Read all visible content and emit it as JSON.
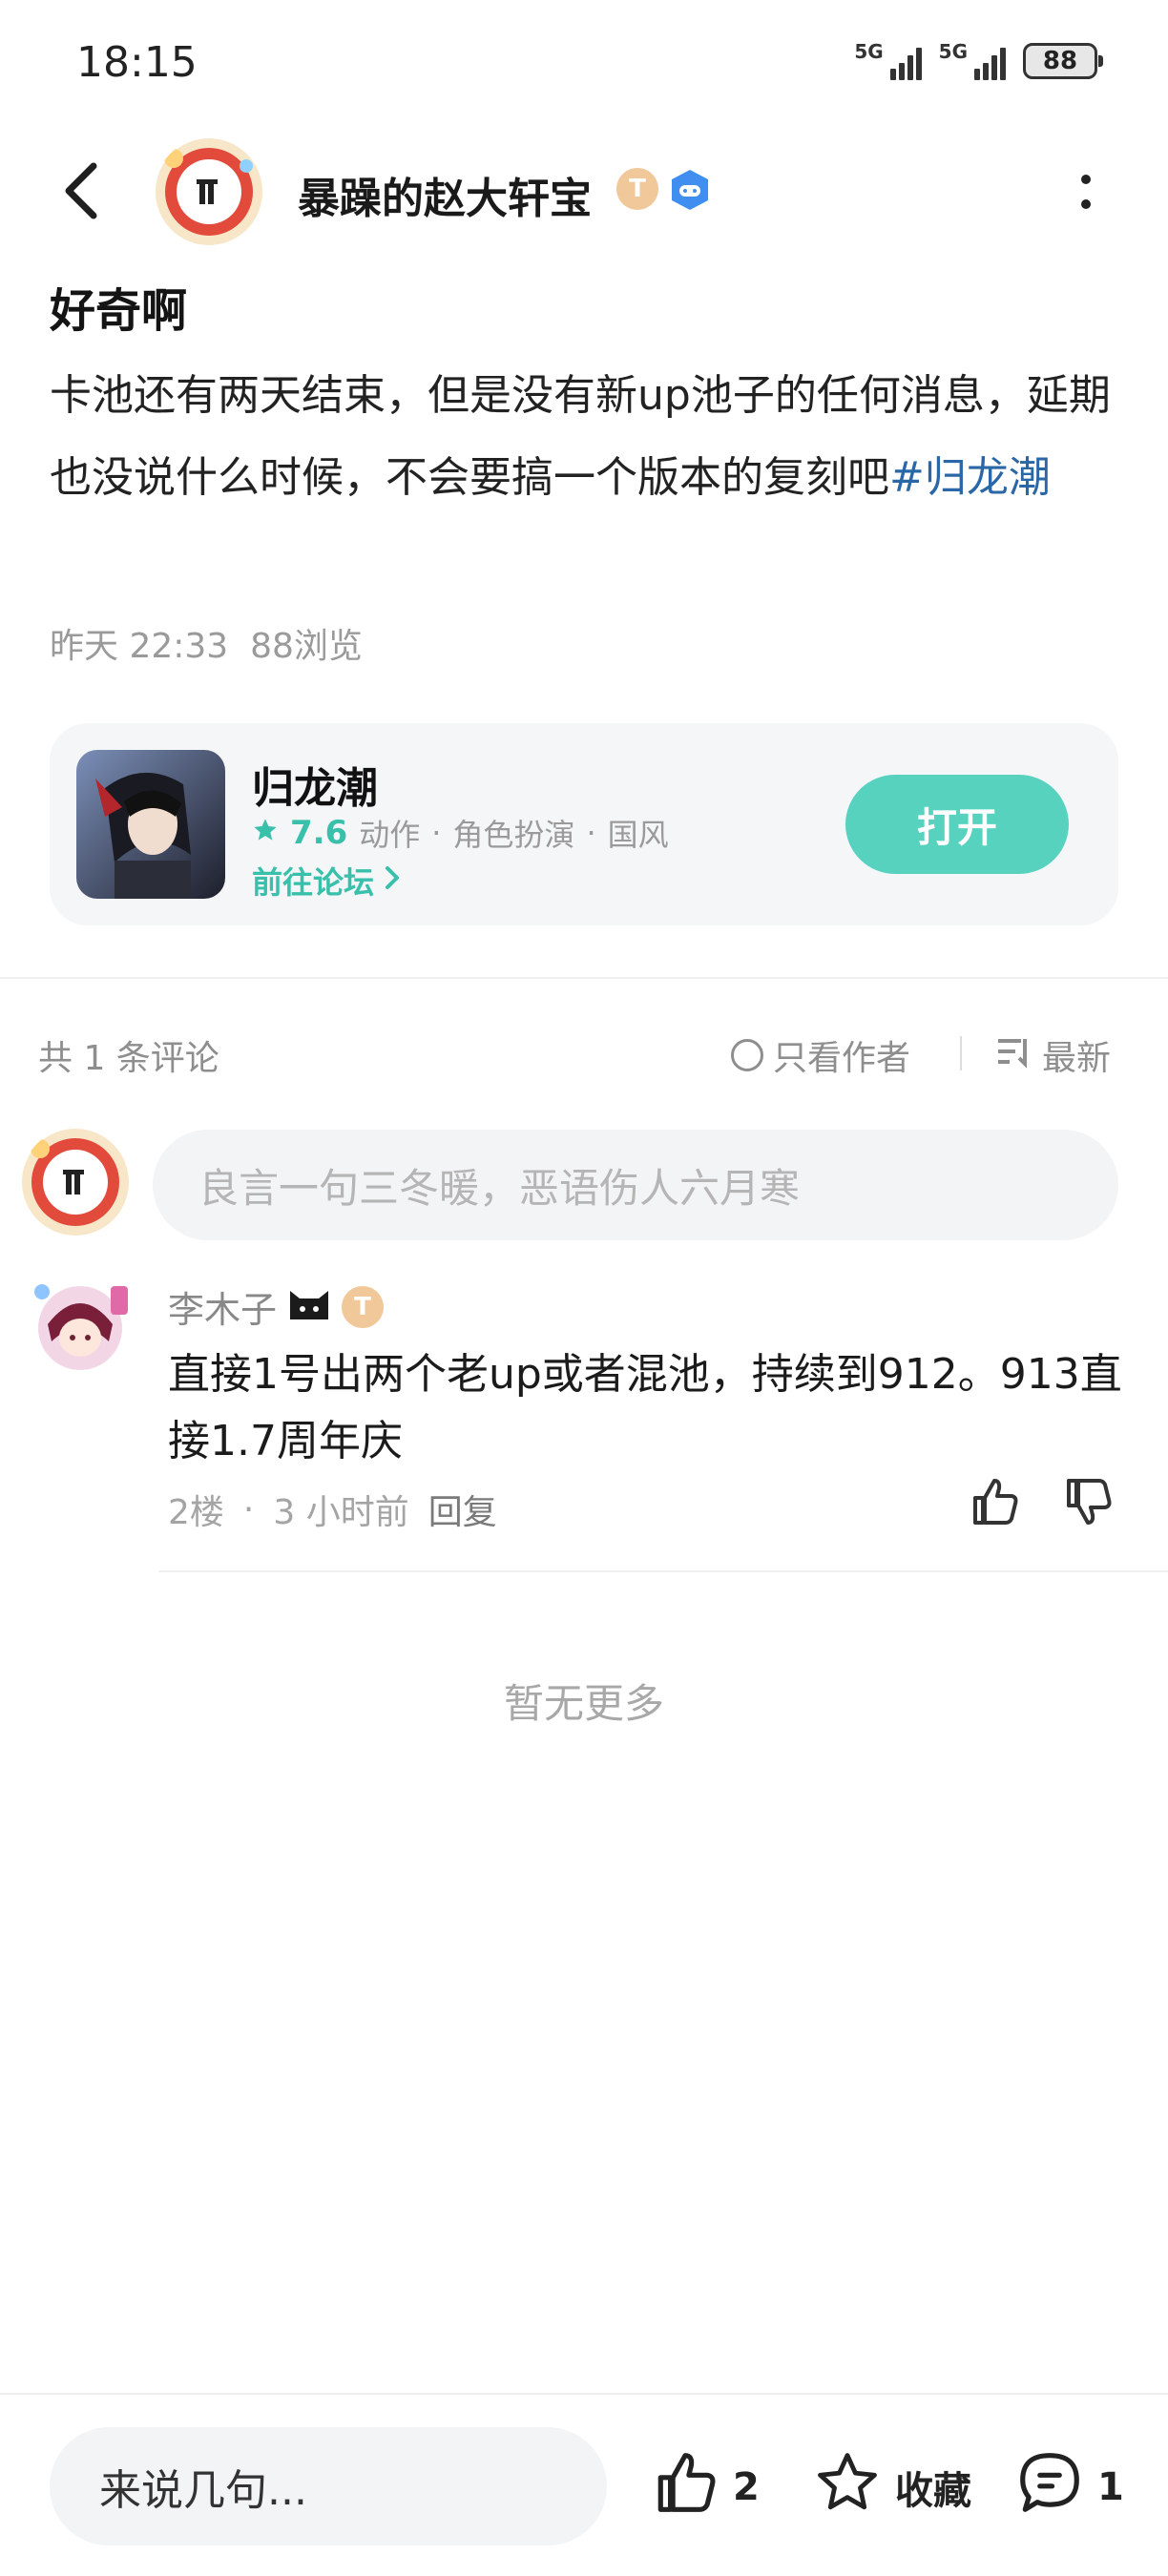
{
  "status_bar": {
    "time": "18:15",
    "signal1_label": "5G",
    "signal2_label": "5G",
    "battery": "88"
  },
  "header": {
    "author_name": "暴躁的赵大轩宝",
    "author_level_badge": "T",
    "back_icon": "back-arrow-icon",
    "more_icon": "more-vertical-icon"
  },
  "post": {
    "title": "好奇啊",
    "body": "卡池还有两天结束，但是没有新up池子的任何消息，延期也没说什么时候，不会要搞一个版本的复刻吧",
    "tag": "#归龙潮",
    "time": "昨天 22:33",
    "views": "88浏览"
  },
  "game_card": {
    "name": "归龙潮",
    "rating": "7.6",
    "genres": [
      "动作",
      "角色扮演",
      "国风"
    ],
    "forum_link": "前往论坛",
    "open_button": "打开",
    "accent_color": "#39c0ab"
  },
  "comments_header": {
    "count_text": "共 1 条评论",
    "author_only": "只看作者",
    "sort": "最新"
  },
  "comment_input": {
    "placeholder": "良言一句三冬暖，恶语伤人六月寒"
  },
  "comments": [
    {
      "author": "李木子",
      "badge": "T",
      "text": "直接1号出两个老up或者混池，持续到912。913直接1.7周年庆",
      "floor": "2楼",
      "time": "3 小时前",
      "reply": "回复"
    }
  ],
  "no_more": "暂无更多",
  "bottom_bar": {
    "input_placeholder": "来说几句...",
    "like_count": "2",
    "favorite_label": "收藏",
    "comment_count": "1"
  }
}
